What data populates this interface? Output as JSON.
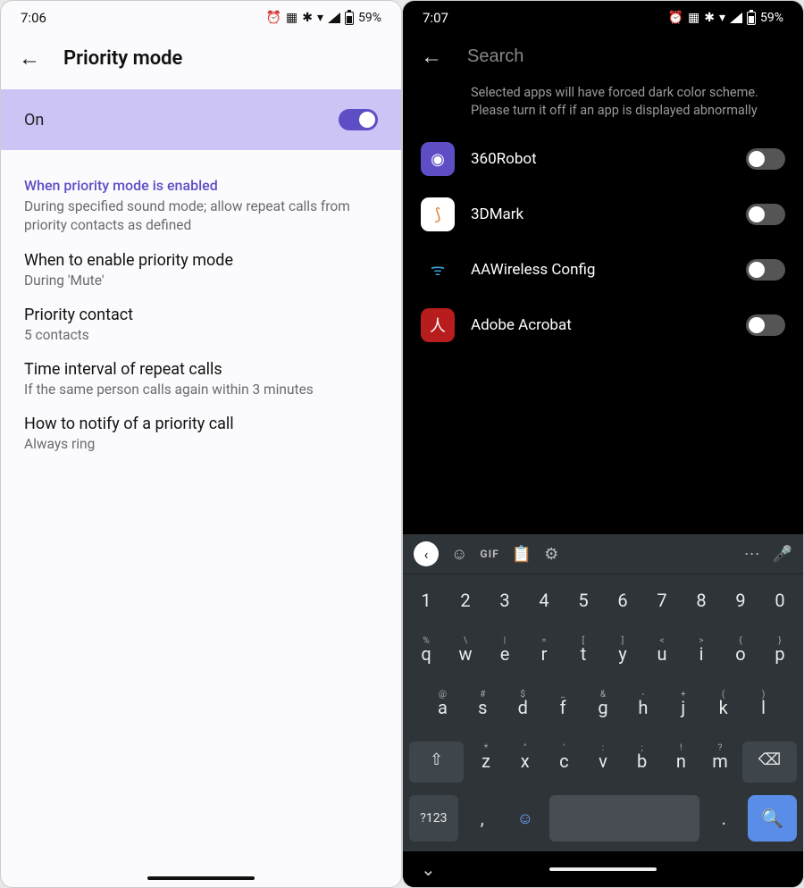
{
  "left": {
    "status": {
      "time": "7:06",
      "battery": "59%",
      "icons": [
        "alarm",
        "cast",
        "bluetooth",
        "wifi",
        "signal",
        "battery"
      ]
    },
    "header": {
      "title": "Priority mode"
    },
    "toggle": {
      "label": "On",
      "state": "on"
    },
    "section": {
      "header": "When priority mode is enabled",
      "sub": "During specified sound mode; allow repeat calls from priority contacts as defined"
    },
    "items": [
      {
        "title": "When to enable priority mode",
        "sub": "During 'Mute'"
      },
      {
        "title": "Priority contact",
        "sub": "5 contacts"
      },
      {
        "title": "Time interval of repeat calls",
        "sub": "If the same person calls again within 3 minutes"
      },
      {
        "title": "How to notify of a priority call",
        "sub": "Always ring"
      }
    ]
  },
  "right": {
    "status": {
      "time": "7:07",
      "battery": "59%",
      "icons": [
        "alarm",
        "cast",
        "bluetooth",
        "wifi",
        "signal",
        "battery"
      ]
    },
    "search": {
      "placeholder": "Search",
      "value": ""
    },
    "desc": "Selected apps will have forced dark color scheme. Please turn it off if an app is displayed abnormally",
    "apps": [
      {
        "name": "360Robot",
        "icon_bg": "#5d4ec6",
        "glyph": "◉",
        "state": "off"
      },
      {
        "name": "3DMark",
        "icon_bg": "#ffffff",
        "glyph": "⟆",
        "glyph_color": "#e07a2b",
        "state": "off"
      },
      {
        "name": "AAWireless Config",
        "icon_bg": "#000000",
        "glyph": "ᯤ",
        "glyph_color": "#3aa0d8",
        "state": "off"
      },
      {
        "name": "Adobe Acrobat",
        "icon_bg": "#b81d1d",
        "glyph": "人",
        "state": "off"
      }
    ],
    "keyboard": {
      "toolbar": [
        "chevron",
        "sticker",
        "GIF",
        "clipboard",
        "settings",
        "more",
        "mic"
      ],
      "row1": [
        "1",
        "2",
        "3",
        "4",
        "5",
        "6",
        "7",
        "8",
        "9",
        "0"
      ],
      "row2": {
        "keys": [
          "q",
          "w",
          "e",
          "r",
          "t",
          "y",
          "u",
          "i",
          "o",
          "p"
        ],
        "sups": [
          "%",
          "\\",
          "|",
          "=",
          "[",
          "]",
          "<",
          ">",
          "{",
          "}"
        ]
      },
      "row3": {
        "keys": [
          "a",
          "s",
          "d",
          "f",
          "g",
          "h",
          "j",
          "k",
          "l"
        ],
        "sups": [
          "@",
          "#",
          "$",
          "_",
          "&",
          "-",
          "+",
          "(",
          ")"
        ]
      },
      "row4": {
        "keys": [
          "z",
          "x",
          "c",
          "v",
          "b",
          "n",
          "m"
        ],
        "sups": [
          "*",
          "\"",
          "'",
          ":",
          ";",
          "!",
          "?"
        ]
      },
      "bottom": {
        "sym": "?123",
        "comma": ",",
        "dot": ".",
        "enter_icon": "search-icon"
      }
    }
  }
}
